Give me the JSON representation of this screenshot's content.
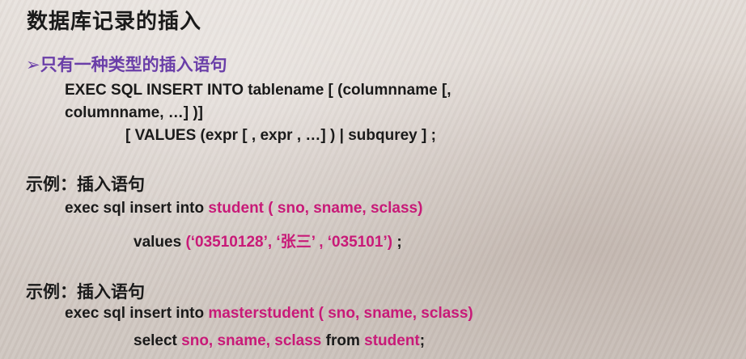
{
  "title": "数据库记录的插入",
  "bullet": "➢只有一种类型的插入语句",
  "syntax": {
    "line1": "EXEC  SQL  INSERT  INTO   tablename  [ (columnname [,",
    "line2": "columnname, …] )]",
    "line3": "[ VALUES  (expr [ , expr , …] ) | subqurey ] ;"
  },
  "example1": {
    "label": "示例：插入语句",
    "prefix": "exec sql  insert  into ",
    "table": "student ( sno, sname, sclass)",
    "values_label": "values  ",
    "values": "(‘03510128’, ‘张三’ , ‘035101’)",
    "values_end": " ;"
  },
  "example2": {
    "label": "示例：插入语句",
    "prefix": "exec sql  insert  into  ",
    "table": "masterstudent ( sno, sname, sclass)",
    "select_kw": "select ",
    "cols": "sno, sname, sclass",
    "from_kw": "  from  ",
    "src": "student",
    "end": ";"
  }
}
